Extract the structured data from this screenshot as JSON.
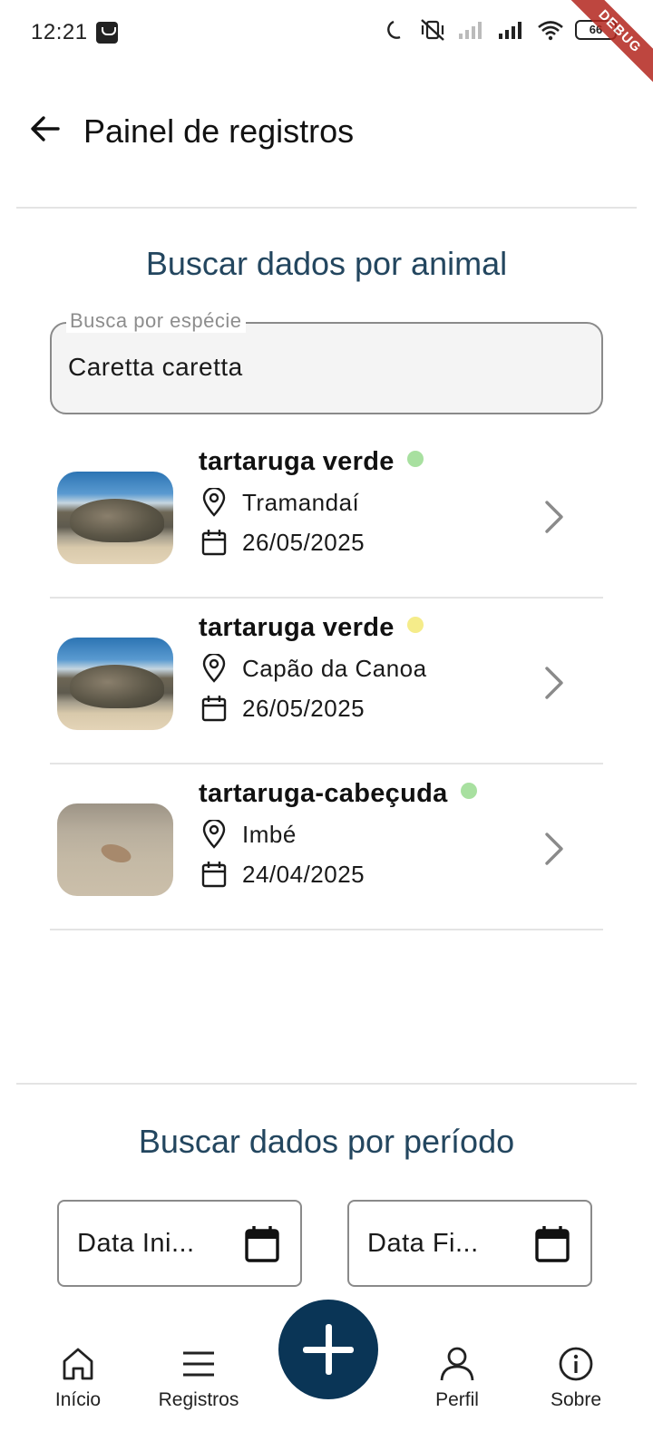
{
  "status_bar": {
    "time": "12:21",
    "battery": "66",
    "debug_banner": "DEBUG",
    "icons": [
      "shopping-bag-icon",
      "moon-icon",
      "vibrate-off-icon",
      "signal-weak-icon",
      "signal-full-icon",
      "wifi-icon",
      "battery-icon"
    ]
  },
  "app_bar": {
    "title": "Painel de registros",
    "back_icon": "arrow-left-icon"
  },
  "animal_search": {
    "title": "Buscar dados por animal",
    "field_label": "Busca por espécie",
    "field_value": "Caretta caretta"
  },
  "records": [
    {
      "name": "tartaruga verde",
      "status_color": "#a8e0a0",
      "location": "Tramandaí",
      "date": "26/05/2025",
      "thumb": "sea-turtle-beach-photo"
    },
    {
      "name": "tartaruga verde",
      "status_color": "#f5ec8a",
      "location": "Capão da Canoa",
      "date": "26/05/2025",
      "thumb": "sea-turtle-beach-photo"
    },
    {
      "name": "tartaruga-cabeçuda",
      "status_color": "#a8e0a0",
      "location": "Imbé",
      "date": "24/04/2025",
      "thumb": "small-turtle-sand-photo"
    }
  ],
  "period_search": {
    "title": "Buscar dados por período",
    "start_label": "Data Ini...",
    "end_label": "Data Fi..."
  },
  "bottom_nav": {
    "items": [
      {
        "label": "Início",
        "icon": "home-icon"
      },
      {
        "label": "Registros",
        "icon": "menu-icon"
      },
      {
        "label": "Perfil",
        "icon": "person-icon"
      },
      {
        "label": "Sobre",
        "icon": "info-icon"
      }
    ],
    "fab_icon": "plus-icon"
  },
  "colors": {
    "section_title": "#23465f",
    "fab": "#0a3556",
    "divider": "#e4e4e4"
  }
}
